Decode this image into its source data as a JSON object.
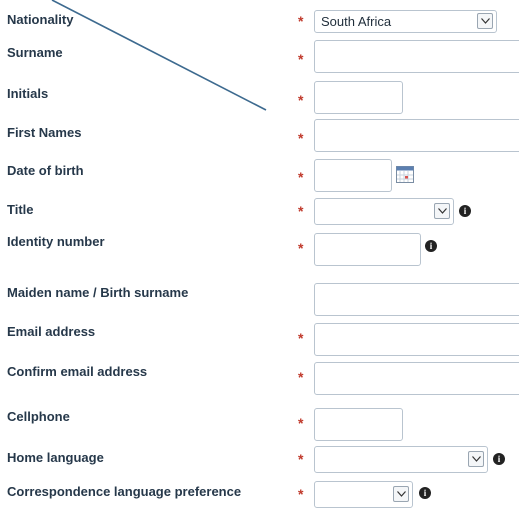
{
  "form": {
    "nationality": {
      "label": "Nationality",
      "selected": "South Africa",
      "required_mark": "*"
    },
    "surname": {
      "label": "Surname",
      "value": "",
      "required_mark": "*"
    },
    "initials": {
      "label": "Initials",
      "value": "",
      "required_mark": "*"
    },
    "first_names": {
      "label": "First Names",
      "value": "",
      "required_mark": "*"
    },
    "date_of_birth": {
      "label": "Date of birth",
      "value": "",
      "required_mark": "*",
      "icon": "calendar-icon"
    },
    "title": {
      "label": "Title",
      "selected": "",
      "required_mark": "*",
      "help_icon": "info-icon"
    },
    "identity_number": {
      "label": "Identity number",
      "value": "",
      "required_mark": "*",
      "help_icon": "info-icon"
    },
    "maiden_name": {
      "label": "Maiden name / Birth surname",
      "value": ""
    },
    "email": {
      "label": "Email address",
      "value": "",
      "required_mark": "*"
    },
    "confirm_email": {
      "label": "Confirm email address",
      "value": "",
      "required_mark": "*"
    },
    "cellphone": {
      "label": "Cellphone",
      "value": "",
      "required_mark": "*"
    },
    "home_language": {
      "label": "Home language",
      "selected": "",
      "required_mark": "*",
      "help_icon": "info-icon"
    },
    "correspondence_language": {
      "label": "Correspondence language preference",
      "selected": "",
      "required_mark": "*",
      "help_icon": "info-icon"
    }
  },
  "colors": {
    "label": "#26384a",
    "required": "#c0392b",
    "border": "#b9c4cf",
    "annotation_line": "#3d6a8f"
  }
}
